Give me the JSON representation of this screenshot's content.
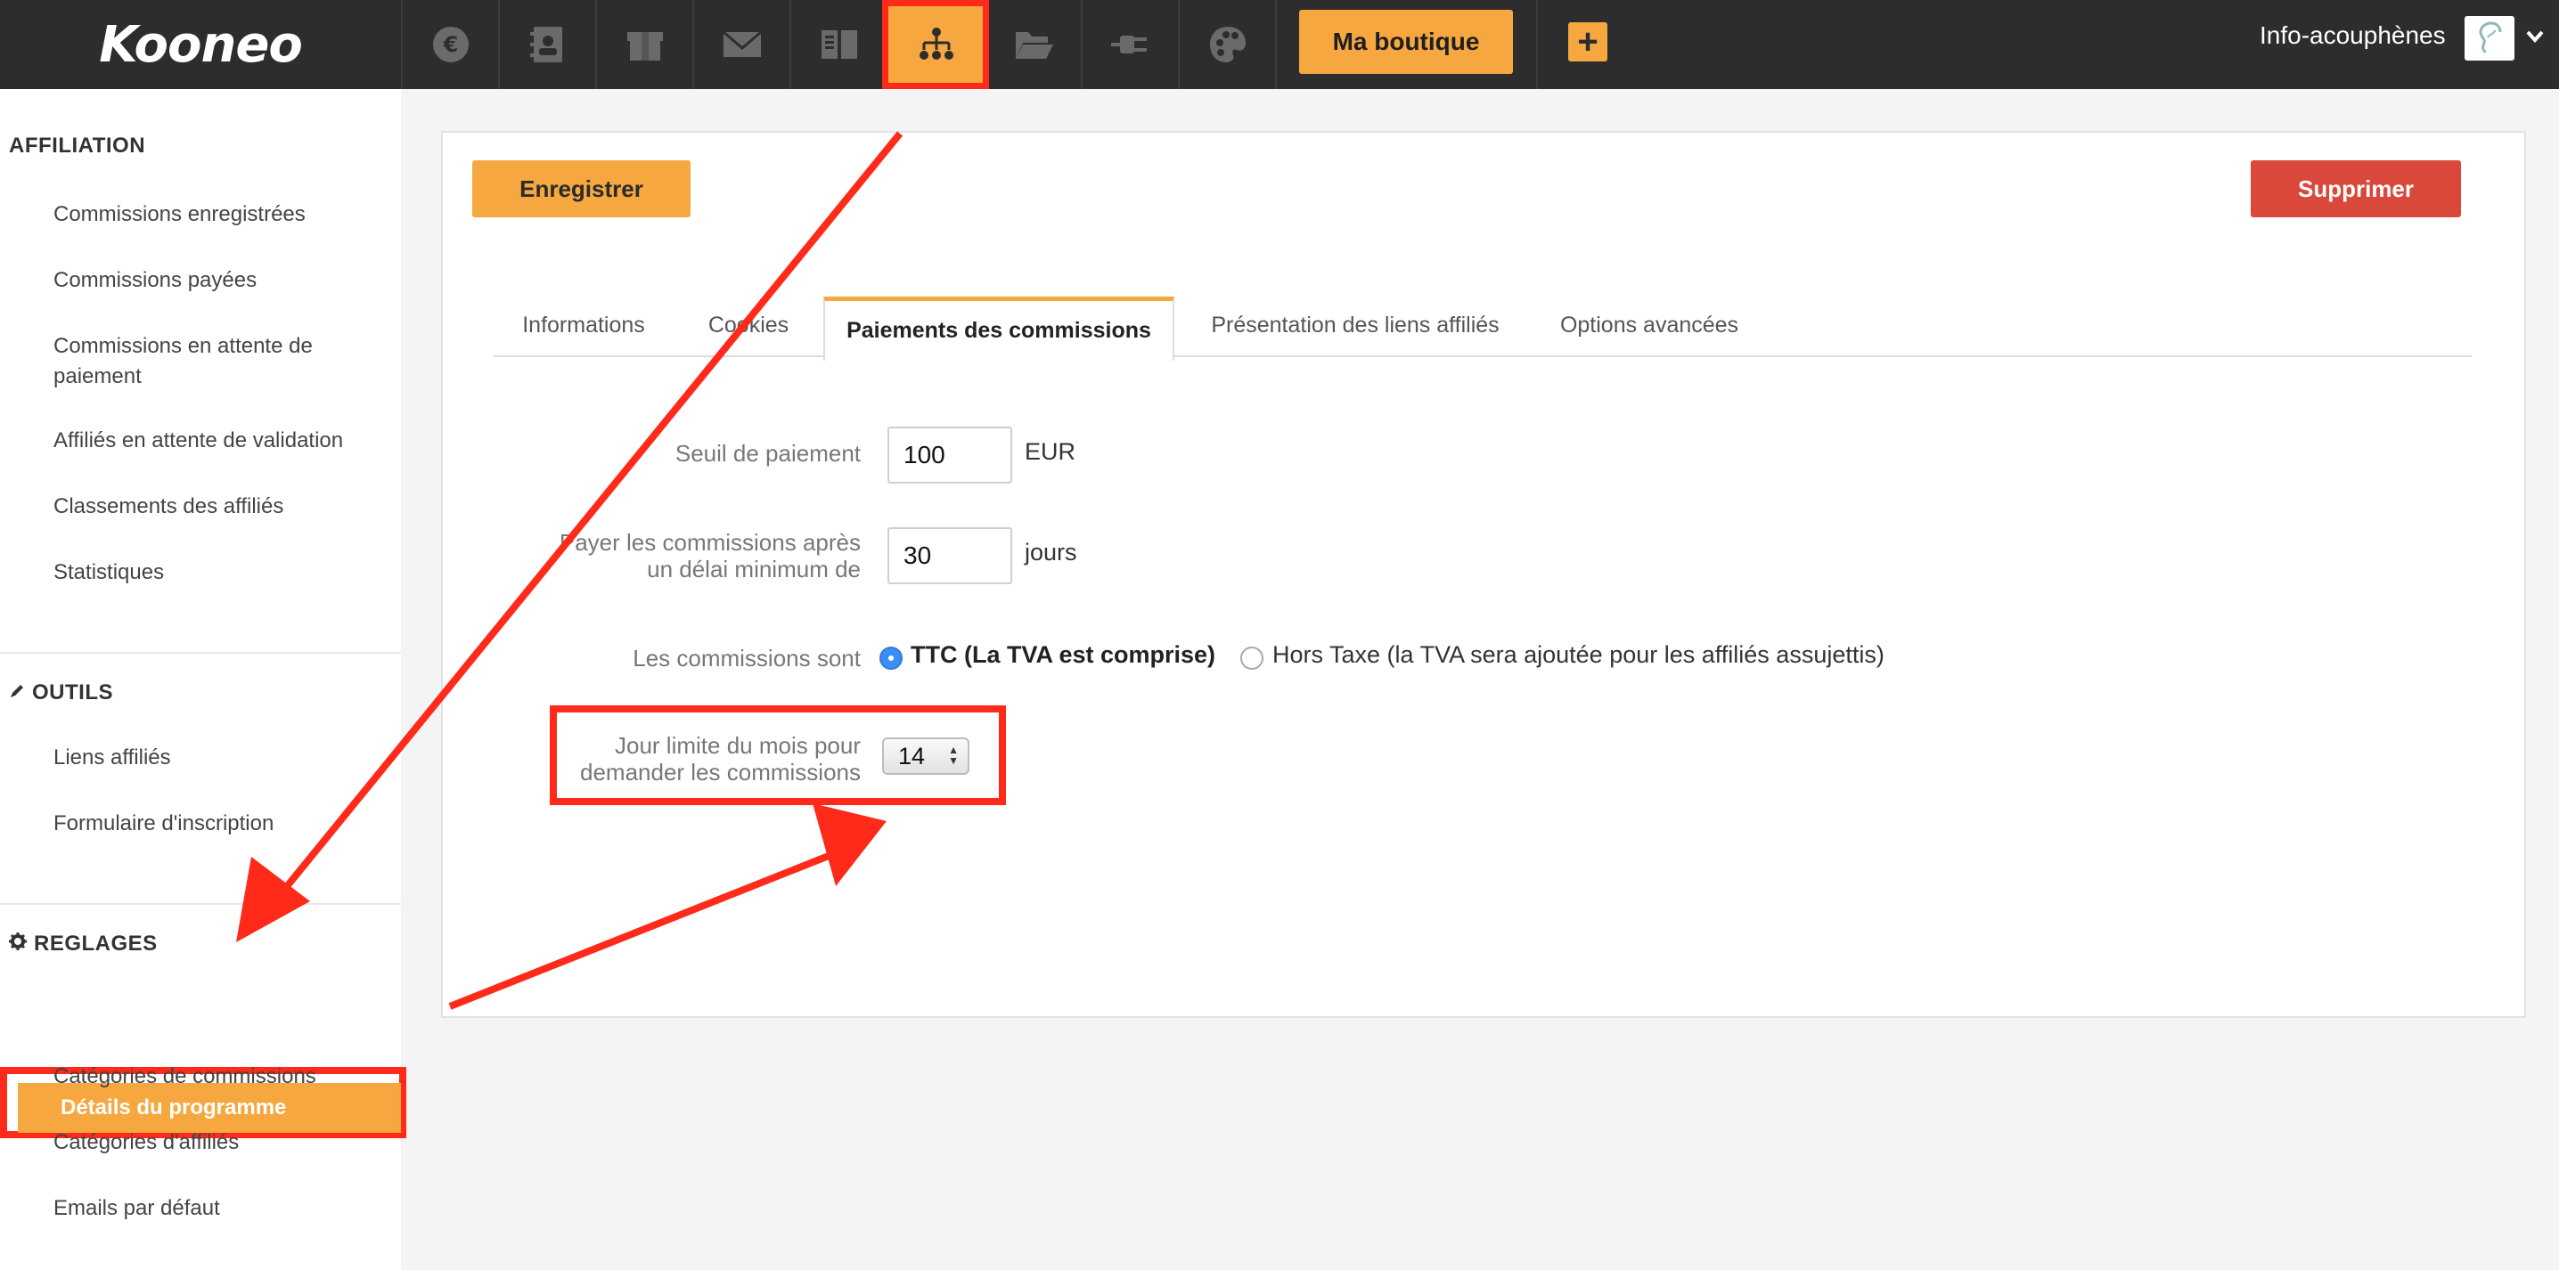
{
  "topbar": {
    "logo": "Kooneo",
    "nav_icons": [
      "euro-icon",
      "contacts-icon",
      "box-icon",
      "mail-icon",
      "book-icon",
      "network-icon",
      "folder-icon",
      "plug-icon",
      "palette-icon"
    ],
    "active_icon": "network-icon",
    "shop_button": "Ma boutique",
    "plus_button": "+",
    "user_name": "Info-acouphènes",
    "accent_color": "#f7a73f",
    "highlight_color": "#ff2a1a"
  },
  "sidebar": {
    "sections": [
      {
        "title": "AFFILIATION",
        "items": [
          "Commissions enregistrées",
          "Commissions payées",
          "Commissions en attente de paiement",
          "Affiliés en attente de validation",
          "Classements des affiliés",
          "Statistiques"
        ]
      },
      {
        "title": "OUTILS",
        "icon": "pencil-icon",
        "items": [
          "Liens affiliés",
          "Formulaire d'inscription"
        ]
      },
      {
        "title": "REGLAGES",
        "icon": "gear-icon",
        "items": [
          "Détails du programme",
          "Catégories de commissions",
          "Catégories d'affiliés",
          "Emails par défaut"
        ]
      }
    ],
    "active_item": "Détails du programme"
  },
  "toolbar": {
    "save_label": "Enregistrer",
    "delete_label": "Supprimer",
    "delete_color": "#d9483b"
  },
  "tabs": [
    "Informations",
    "Cookies",
    "Paiements des commissions",
    "Présentation des liens affiliés",
    "Options avancées"
  ],
  "active_tab": "Paiements des commissions",
  "form": {
    "threshold_label": "Seuil de paiement",
    "threshold_value": "100",
    "threshold_unit": "EUR",
    "delay_label_line1": "Payer les commissions après",
    "delay_label_line2": "un délai minimum de",
    "delay_value": "30",
    "delay_unit": "jours",
    "tax_label": "Les commissions sont",
    "tax_option_ttc": "TTC (La TVA est comprise)",
    "tax_option_ht": "Hors Taxe (la TVA sera ajoutée pour les affiliés assujettis)",
    "tax_selected": "TTC (La TVA est comprise)",
    "day_limit_label_line1": "Jour limite du mois pour",
    "day_limit_label_line2": "demander les commissions",
    "day_limit_value": "14"
  }
}
